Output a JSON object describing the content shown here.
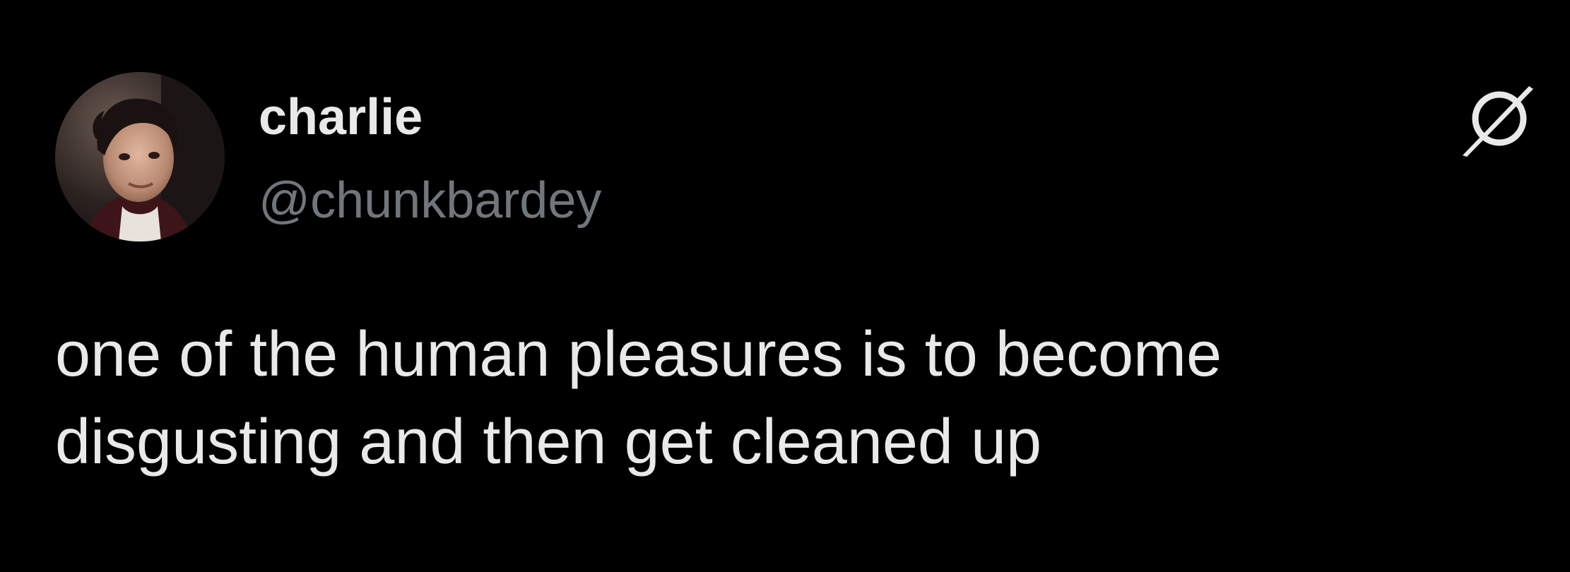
{
  "tweet": {
    "author": {
      "display_name": "charlie",
      "handle": "@chunkbardey"
    },
    "text_lines": [
      "one of the human pleasures is to become",
      "disgusting and then get cleaned up"
    ],
    "logo_icon": "slashed-circle-logo-icon"
  },
  "colors": {
    "background": "#000000",
    "primary_text": "#e7e9ea",
    "secondary_text": "#71767b"
  }
}
